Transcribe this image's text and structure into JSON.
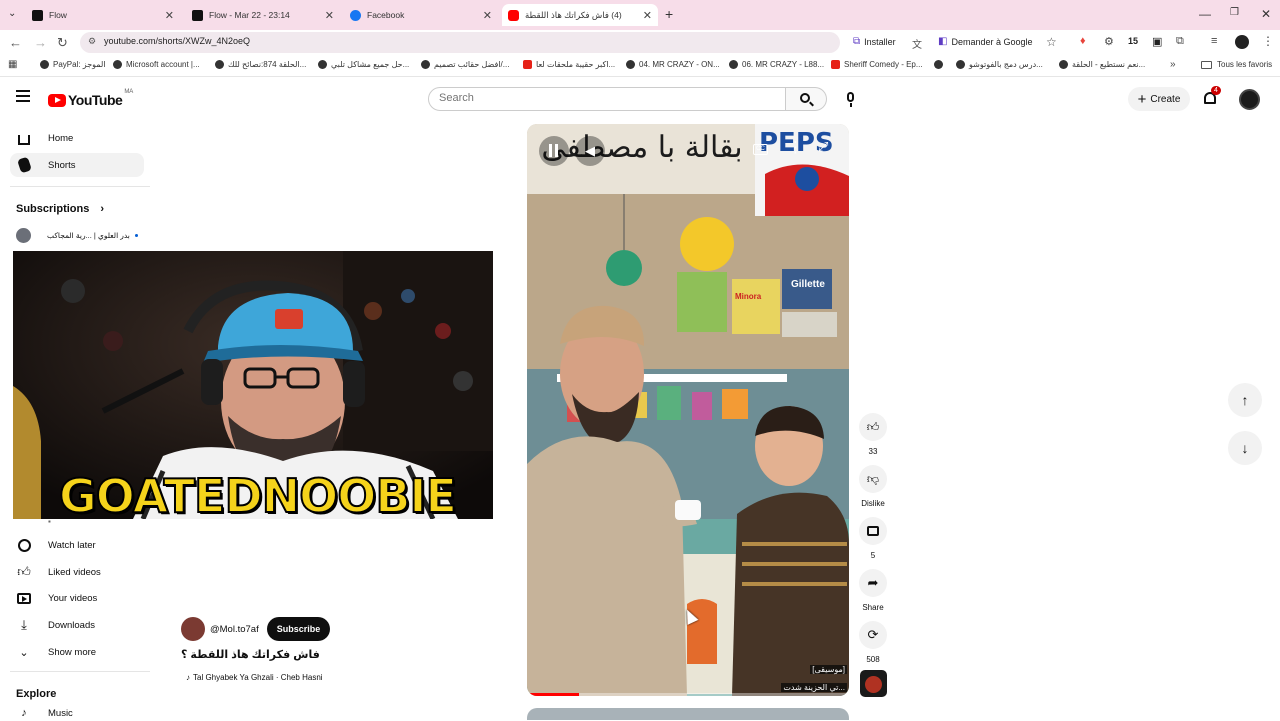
{
  "browser": {
    "tabs": [
      {
        "title": "Flow",
        "icon": "flow-icon"
      },
      {
        "title": "Flow - Mar 22 - 23:14",
        "icon": "flow-icon"
      },
      {
        "title": "Facebook",
        "icon": "facebook-icon"
      },
      {
        "title": "(4) فاش فكراتك هاذ اللقطة",
        "icon": "youtube-icon",
        "active": true
      }
    ],
    "url": "youtube.com/shorts/XWZw_4N2oeQ",
    "toolbar": {
      "install_label": "Installer",
      "ask_google_label": "Demander à Google",
      "badge_count": "15"
    },
    "bookmarks": [
      "PayPal: الموجز",
      "Microsoft account |...",
      "الحلقة 874:نصائح للك...",
      "حل جميع مشاكل تلبي...",
      "افضل حقائب تصميم/...",
      "اكبر حقيبة ملحقات لعا...",
      "04. MR CRAZY - ON...",
      "06. MR CRAZY - L88...",
      "Sheriff Comedy - Ep...",
      "",
      "درس دمج بالفوتوشو...",
      "نعم نستطيع - الحلقة..."
    ],
    "all_bookmarks_label": "Tous les favoris"
  },
  "youtube": {
    "logo_text": "YouTube",
    "region": "MA",
    "search_placeholder": "Search",
    "create_label": "Create",
    "notifications_count": "4",
    "sidebar": {
      "home": "Home",
      "shorts": "Shorts",
      "subscriptions_title": "Subscriptions",
      "subscription_channel": "بدر العلوي | ...رية المجاكب",
      "watch_later": "Watch later",
      "liked_videos": "Liked videos",
      "your_videos": "Your videos",
      "downloads": "Downloads",
      "show_more": "Show more",
      "explore_title": "Explore",
      "music": "Music"
    },
    "pip_overlay_text": "GOATEDNOOBIE",
    "short": {
      "channel": "@Mol.to7af",
      "subscribe_label": "Subscribe",
      "title": "فاش فكراتك هاذ اللقطة ؟",
      "music": "Tal Ghyabek Ya Ghzali · Cheb Hasni",
      "caption_line1": "[موسيقى]",
      "caption_line2": "...تي الحزينة شدت",
      "sign_text": "بقالة با مصطفى",
      "pepsi_text": "PEPS",
      "gillette_text": "Gillette",
      "minora_text": "Minora",
      "progress": 0.16
    },
    "actions": {
      "likes": "33",
      "dislike": "Dislike",
      "comments": "5",
      "share": "Share",
      "remix": "508"
    },
    "colors": {
      "brand_red": "#ff0000",
      "accent": "#0f0f0f",
      "tab_strip": "#f7dde9"
    }
  }
}
